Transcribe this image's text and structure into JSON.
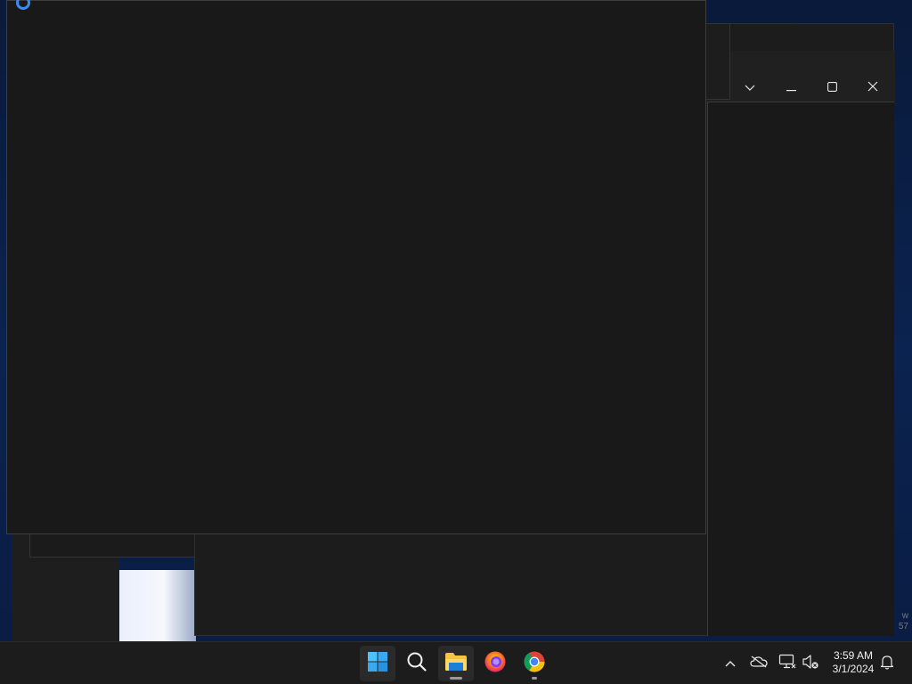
{
  "explorer_window": {
    "controls": {
      "expand_icon": "chevron-down-icon",
      "minimize_icon": "minimize-icon",
      "maximize_icon": "maximize-icon",
      "close_icon": "close-icon"
    }
  },
  "edge_text": {
    "line1": "w",
    "line2": "57"
  },
  "taskbar": {
    "apps": [
      {
        "name": "Start",
        "icon": "windows-logo-icon"
      },
      {
        "name": "Search",
        "icon": "search-icon"
      },
      {
        "name": "File Explorer",
        "icon": "folder-icon",
        "running": true
      },
      {
        "name": "Firefox",
        "icon": "firefox-icon"
      },
      {
        "name": "Google Chrome",
        "icon": "chrome-icon",
        "running": true
      }
    ],
    "tray": {
      "icons": [
        "chevron-up-icon",
        "onedrive-offline-icon",
        "network-icon",
        "volume-muted-icon",
        "notification-bell-icon"
      ]
    },
    "clock": {
      "time": "3:59 AM",
      "date": "3/1/2024"
    }
  },
  "colors": {
    "window_bg": "#191919",
    "taskbar_bg": "#1c1c1c",
    "accent_blue": "#3b8cf0",
    "folder_yellow": "#f5c542"
  }
}
